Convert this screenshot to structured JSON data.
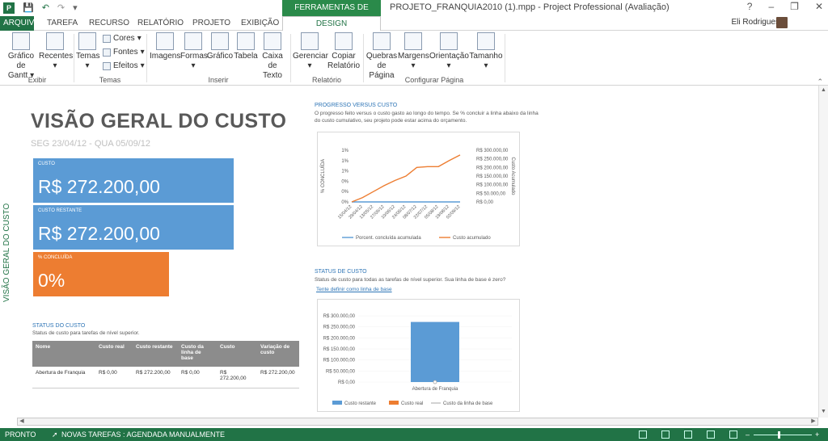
{
  "titlebar": {
    "context_tab_header": "FERRAMENTAS DE RELATÓRIO",
    "window_title": "PROJETO_FRANQUIA2010 (1).mpp - Project Professional (Avaliação)",
    "help": "?",
    "minimize": "–",
    "restore": "❐",
    "close": "✕"
  },
  "tabs": {
    "file": "ARQUIVO",
    "items": [
      "TAREFA",
      "RECURSO",
      "RELATÓRIO",
      "PROJETO",
      "EXIBIÇÃO"
    ],
    "design": "DESIGN"
  },
  "user": {
    "name": "Eli Rodrigues"
  },
  "ribbon": {
    "exibir": {
      "gantt": "Gráfico de",
      "gantt2": "Gantt",
      "recentes": "Recentes",
      "label": "Exibir"
    },
    "temas": {
      "temas": "Temas",
      "cores": "Cores",
      "fontes": "Fontes",
      "efeitos": "Efeitos",
      "label": "Temas"
    },
    "inserir": {
      "imagens": "Imagens",
      "formas": "Formas",
      "grafico": "Gráfico",
      "tabela": "Tabela",
      "caixa": "Caixa de",
      "caixa2": "Texto",
      "label": "Inserir"
    },
    "relatorio": {
      "gerenciar": "Gerenciar",
      "copiar": "Copiar",
      "copiar2": "Relatório",
      "label": "Relatório"
    },
    "config": {
      "quebras": "Quebras",
      "quebras2": "de Página",
      "margens": "Margens",
      "orientacao": "Orientação",
      "tamanho": "Tamanho",
      "label": "Configurar Página"
    }
  },
  "report": {
    "side_label": "VISÃO GERAL DO CUSTO",
    "title": "VISÃO GERAL DO CUSTO",
    "dates": "SEG 23/04/12 -   QUA 05/09/12",
    "cards": [
      {
        "label": "CUSTO",
        "value": "R$ 272.200,00",
        "color": "#5b9bd5"
      },
      {
        "label": "CUSTO RESTANTE",
        "value": "R$ 272.200,00",
        "color": "#5b9bd5"
      },
      {
        "label": "% CONCLUÍDA",
        "value": "0%",
        "color": "#ed7d31"
      }
    ],
    "status_section": {
      "title": "STATUS DO CUSTO",
      "subtitle": "Status de custo para tarefas de nível superior.",
      "headers": [
        "Nome",
        "Custo real",
        "Custo restante",
        "Custo da linha de base",
        "Custo",
        "Variação de custo"
      ],
      "rows": [
        [
          "Abertura de Franquia",
          "R$ 0,00",
          "R$ 272.200,00",
          "R$ 0,00",
          "R$ 272.200,00",
          "R$ 272.200,00"
        ]
      ]
    },
    "progress_section": {
      "title": "PROGRESSO VERSUS CUSTO",
      "subtitle1": "O progresso feito versus o custo gasto ao longo do tempo. Se % concluir a linha abaixo da linha",
      "subtitle2": "do custo cumulativo, seu projeto pode estar acima do orçamento."
    },
    "cost_status_section": {
      "title": "STATUS DE CUSTO",
      "subtitle": "Status de custo para todas as tarefas de nível superior. Sua linha de base é zero?",
      "link": "Tente definir como linha de base"
    }
  },
  "chart_data": [
    {
      "type": "line",
      "title": "",
      "x": [
        "15/04/12",
        "29/04/12",
        "13/05/12",
        "27/05/12",
        "10/06/12",
        "24/06/12",
        "08/07/12",
        "22/07/12",
        "05/08/12",
        "19/08/12",
        "02/09/12"
      ],
      "ylabel": "% CONCLUÍDA",
      "y2label": "Custo Acumulado",
      "y_ticks": [
        "0%",
        "0%",
        "0%",
        "1%",
        "1%",
        "1%"
      ],
      "y2_ticks": [
        "R$ 0,00",
        "R$ 50.000,00",
        "R$ 100.000,00",
        "R$ 150.000,00",
        "R$ 200.000,00",
        "R$ 250.000,00",
        "R$ 300.000,00"
      ],
      "y2lim": [
        0,
        300000
      ],
      "series": [
        {
          "name": "Porcent. concluída acumulada",
          "color": "#5b9bd5",
          "axis": "left",
          "values": [
            0,
            0,
            0,
            0,
            0,
            0,
            0,
            0,
            0,
            0,
            0
          ]
        },
        {
          "name": "Custo acumulado",
          "color": "#ed7d31",
          "axis": "right",
          "values": [
            0,
            25000,
            60000,
            95000,
            125000,
            150000,
            200000,
            205000,
            205000,
            240000,
            272200
          ]
        }
      ],
      "legend": "bottom"
    },
    {
      "type": "bar",
      "categories": [
        "Abertura de Franquia"
      ],
      "ylim": [
        0,
        300000
      ],
      "y_ticks": [
        "R$ 0,00",
        "R$ 50.000,00",
        "R$ 100.000,00",
        "R$ 150.000,00",
        "R$ 200.000,00",
        "R$ 250.000,00",
        "R$ 300.000,00"
      ],
      "series": [
        {
          "name": "Custo restante",
          "color": "#5b9bd5",
          "values": [
            272200
          ]
        },
        {
          "name": "Custo real",
          "color": "#ed7d31",
          "values": [
            0
          ]
        },
        {
          "name": "Custo da linha de base",
          "color": "#a5a5a5",
          "values": [
            0
          ]
        }
      ],
      "legend": "bottom"
    }
  ],
  "statusbar": {
    "ready": "PRONTO",
    "new_tasks": "NOVAS TAREFAS : AGENDADA MANUALMENTE"
  }
}
